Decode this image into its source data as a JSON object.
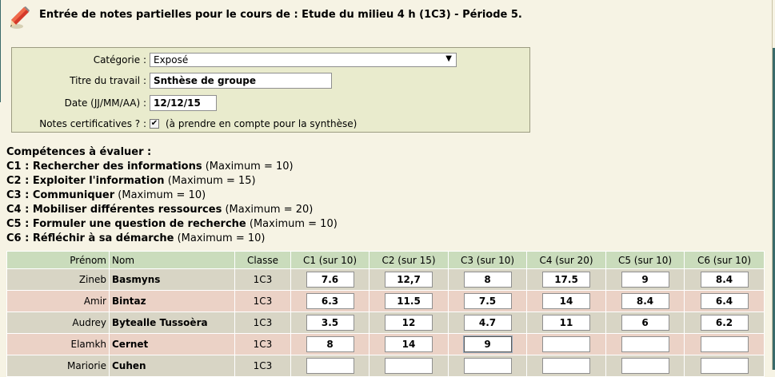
{
  "title": "Entrée de notes partielles pour le cours de : Etude du milieu 4 h (1C3) - Période 5.",
  "form": {
    "categorie_label": "Catégorie :",
    "categorie_value": "Exposé",
    "titre_label": "Titre du travail :",
    "titre_value": "Snthèse de groupe",
    "date_label": "Date (JJ/MM/AA) :",
    "date_value": "12/12/15",
    "certif_label": "Notes certificatives ? :",
    "certif_checked": true,
    "certif_checkmark": "✔",
    "certif_note": "(à prendre en compte pour la synthèse)"
  },
  "competences": {
    "heading": "Compétences à évaluer :",
    "items": [
      {
        "name": "C1 : Rechercher des informations",
        "max": "(Maximum = 10)"
      },
      {
        "name": "C2 : Exploiter l'information",
        "max": "(Maximum = 15)"
      },
      {
        "name": "C3 : Communiquer",
        "max": "(Maximum = 10)"
      },
      {
        "name": "C4 : Mobiliser différentes ressources",
        "max": "(Maximum = 20)"
      },
      {
        "name": "C5 : Formuler une question de recherche",
        "max": "(Maximum = 10)"
      },
      {
        "name": "C6 : Réfléchir à sa démarche",
        "max": "(Maximum = 10)"
      }
    ]
  },
  "table": {
    "headers": [
      "Prénom",
      "Nom",
      "Classe",
      "C1 (sur 10)",
      "C2 (sur 15)",
      "C3 (sur 10)",
      "C4 (sur 20)",
      "C5 (sur 10)",
      "C6 (sur 10)"
    ],
    "rows": [
      {
        "prenom": "Zineb",
        "nom": "Basmyns",
        "classe": "1C3",
        "scores": [
          "7.6",
          "12,7",
          "8",
          "17.5",
          "9",
          "8.4"
        ]
      },
      {
        "prenom": "Amir",
        "nom": "Bintaz",
        "classe": "1C3",
        "scores": [
          "6.3",
          "11.5",
          "7.5",
          "14",
          "8.4",
          "6.4"
        ]
      },
      {
        "prenom": "Audrey",
        "nom": "Bytealle Tussoèra",
        "classe": "1C3",
        "scores": [
          "3.5",
          "12",
          "4.7",
          "11",
          "6",
          "6.2"
        ]
      },
      {
        "prenom": "Elamkh",
        "nom": "Cernet",
        "classe": "1C3",
        "scores": [
          "8",
          "14",
          "9",
          "",
          "",
          ""
        ]
      },
      {
        "prenom": "Mariorie",
        "nom": "Cuhen",
        "classe": "1C3",
        "scores": [
          "",
          "",
          "",
          "",
          "",
          ""
        ]
      }
    ]
  },
  "colors": {
    "page_bg": "#f6f3e4",
    "form_bg": "#e9ebcd",
    "header_row": "#cadcbc",
    "row_gray": "#d8d5c5",
    "row_pink": "#ebd2c6",
    "pencil_red": "#d43a2a"
  },
  "icons": {
    "header": "pencil-edit-icon",
    "dropdown": "chevron-down-icon",
    "checkbox": "checkmark-icon"
  }
}
